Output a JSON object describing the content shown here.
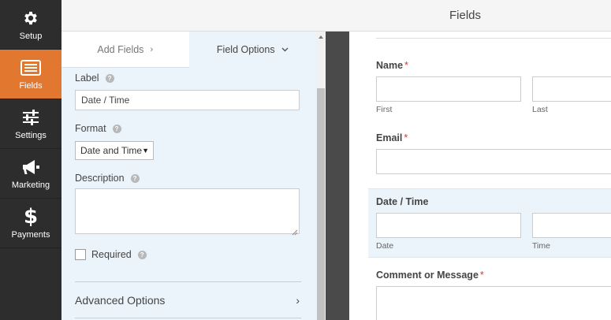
{
  "sidebar": {
    "items": [
      {
        "label": "Setup",
        "icon": "gear-icon",
        "active": false
      },
      {
        "label": "Fields",
        "icon": "list-icon",
        "active": true
      },
      {
        "label": "Settings",
        "icon": "sliders-icon",
        "active": false
      },
      {
        "label": "Marketing",
        "icon": "megaphone-icon",
        "active": false
      },
      {
        "label": "Payments",
        "icon": "dollar-icon",
        "glyph": "$",
        "active": false
      }
    ]
  },
  "header": {
    "title": "Fields"
  },
  "options_panel": {
    "tabs": [
      {
        "label": "Add Fields",
        "chevron": "›"
      },
      {
        "label": "Field Options",
        "chevron": "⌄"
      }
    ],
    "label_field": {
      "label": "Label",
      "help": "?",
      "value": "Date / Time"
    },
    "format_field": {
      "label": "Format",
      "help": "?",
      "selected": "Date and Time"
    },
    "description_field": {
      "label": "Description",
      "help": "?",
      "value": ""
    },
    "required_field": {
      "label": "Required",
      "help": "?",
      "checked": false
    },
    "advanced": {
      "label": "Advanced Options",
      "chevron": "›"
    }
  },
  "preview": {
    "name": {
      "label": "Name",
      "required_mark": "*",
      "sub_first": "First",
      "sub_last": "Last"
    },
    "email": {
      "label": "Email",
      "required_mark": "*"
    },
    "datetime": {
      "label": "Date / Time",
      "sub_date": "Date",
      "sub_time": "Time"
    },
    "comment": {
      "label": "Comment or Message",
      "required_mark": "*"
    }
  },
  "colors": {
    "accent": "#e27730",
    "sidebar_bg": "#2d2d2d",
    "panel_bg": "#ebf3fb",
    "required": "#d63638"
  }
}
